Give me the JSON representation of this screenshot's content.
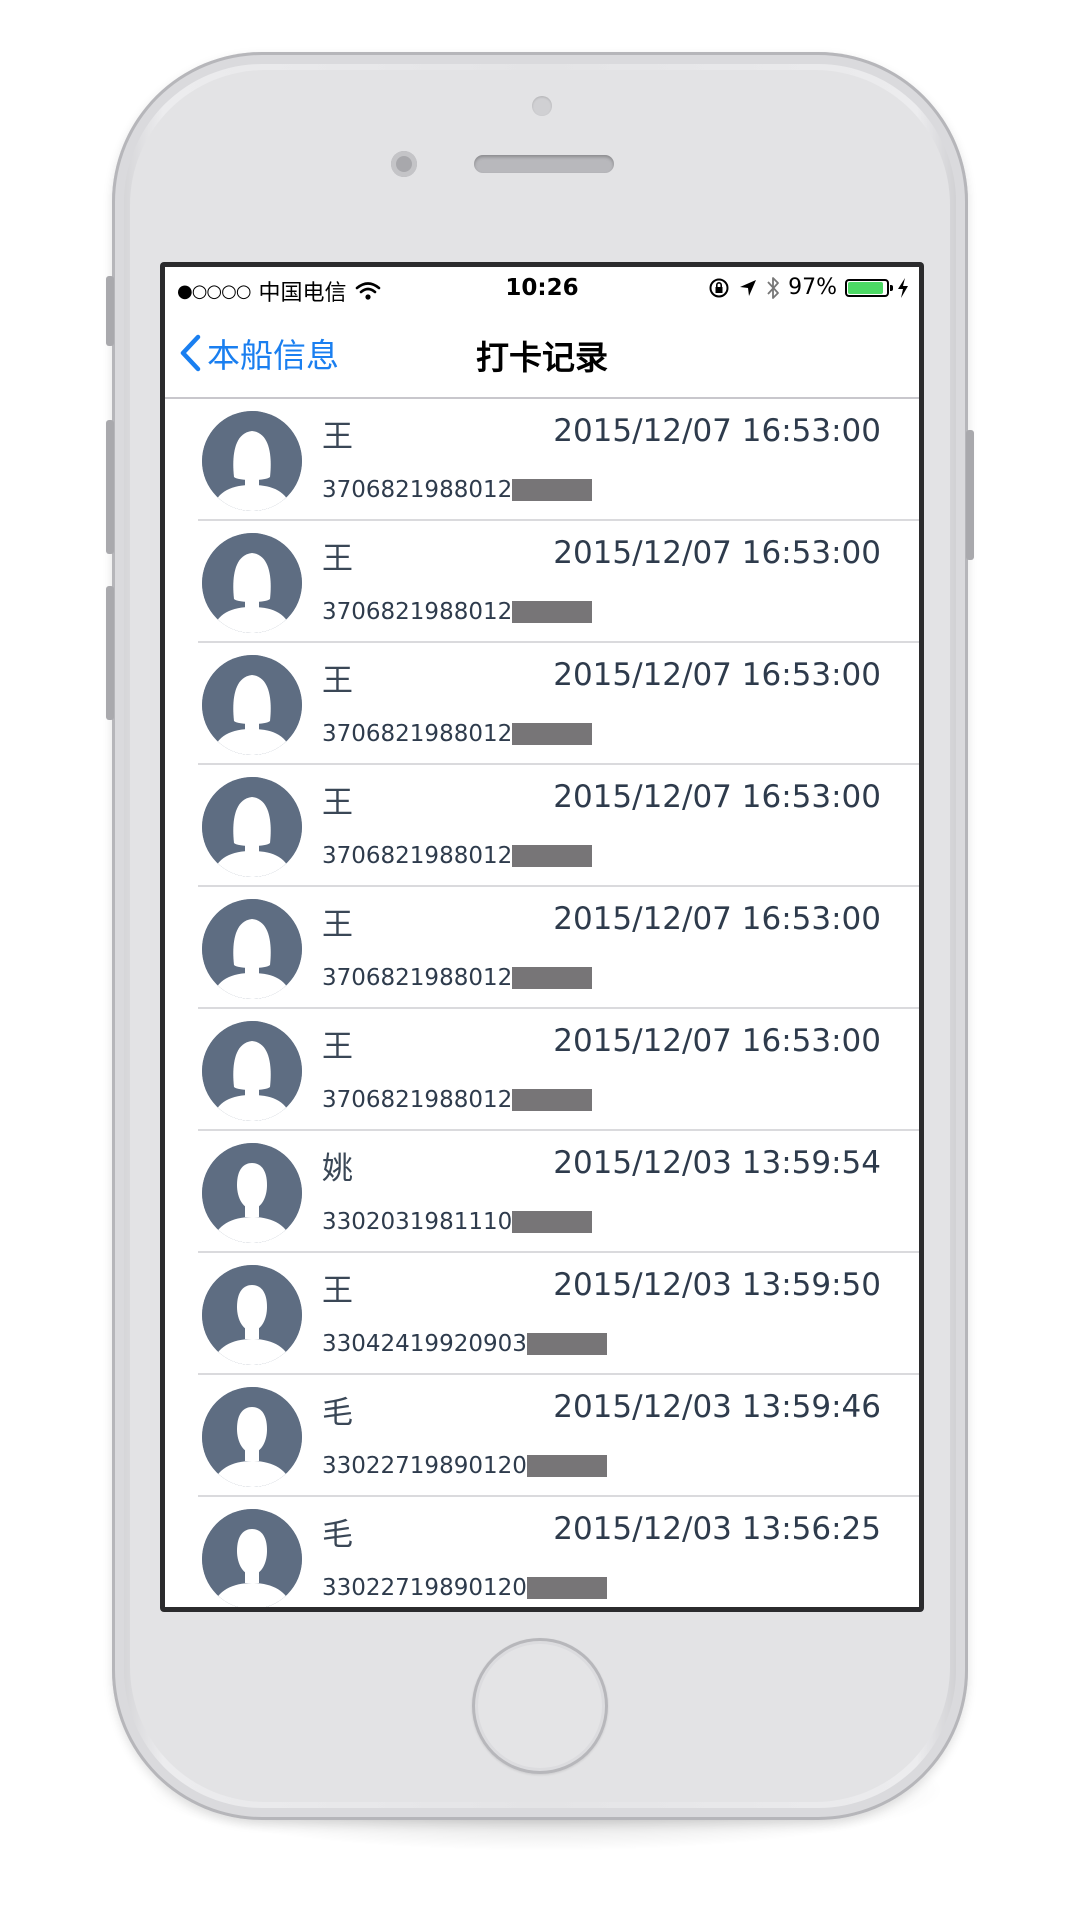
{
  "status_bar": {
    "signal": "●○○○○",
    "carrier": "中国电信",
    "time": "10:26",
    "battery_percent": "97%",
    "battery_level": 0.97
  },
  "nav": {
    "back_label": "本船信息",
    "title": "打卡记录"
  },
  "colors": {
    "accent": "#1a7ff0",
    "avatar_bg": "#5e6d82",
    "battery_green": "#4cd964",
    "redaction": "#777577"
  },
  "records": [
    {
      "name": "王",
      "time": "2015/12/07 16:53:00",
      "id_prefix": "3706821988012",
      "avatar": "female-avatar-icon"
    },
    {
      "name": "王",
      "time": "2015/12/07 16:53:00",
      "id_prefix": "3706821988012",
      "avatar": "female-avatar-icon"
    },
    {
      "name": "王",
      "time": "2015/12/07 16:53:00",
      "id_prefix": "3706821988012",
      "avatar": "female-avatar-icon"
    },
    {
      "name": "王",
      "time": "2015/12/07 16:53:00",
      "id_prefix": "3706821988012",
      "avatar": "female-avatar-icon"
    },
    {
      "name": "王",
      "time": "2015/12/07 16:53:00",
      "id_prefix": "3706821988012",
      "avatar": "female-avatar-icon"
    },
    {
      "name": "王",
      "time": "2015/12/07 16:53:00",
      "id_prefix": "3706821988012",
      "avatar": "female-avatar-icon"
    },
    {
      "name": "姚",
      "time": "2015/12/03 13:59:54",
      "id_prefix": "3302031981110",
      "avatar": "male-avatar-icon"
    },
    {
      "name": "王",
      "time": "2015/12/03 13:59:50",
      "id_prefix": "33042419920903",
      "avatar": "male-avatar-icon"
    },
    {
      "name": "毛",
      "time": "2015/12/03 13:59:46",
      "id_prefix": "33022719890120",
      "avatar": "male-avatar-icon"
    },
    {
      "name": "毛",
      "time": "2015/12/03 13:56:25",
      "id_prefix": "33022719890120",
      "avatar": "male-avatar-icon"
    }
  ]
}
